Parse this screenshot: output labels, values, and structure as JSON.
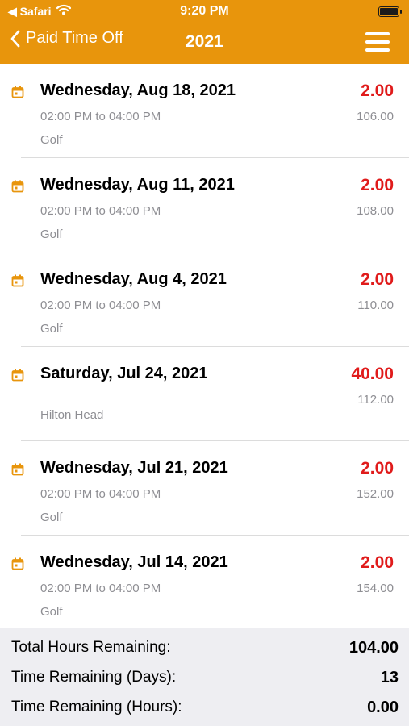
{
  "status_bar": {
    "back_app": "◀ Safari",
    "time": "9:20 PM"
  },
  "nav": {
    "back_label": "Paid Time Off",
    "title": "2021"
  },
  "entries": [
    {
      "date": "Wednesday, Aug 18, 2021",
      "time": "02:00 PM to 04:00 PM",
      "note": "Golf",
      "hours": "2.00",
      "balance": "106.00"
    },
    {
      "date": "Wednesday, Aug 11, 2021",
      "time": "02:00 PM to 04:00 PM",
      "note": "Golf",
      "hours": "2.00",
      "balance": "108.00"
    },
    {
      "date": "Wednesday, Aug 4, 2021",
      "time": "02:00 PM to 04:00 PM",
      "note": "Golf",
      "hours": "2.00",
      "balance": "110.00"
    },
    {
      "date": "Saturday, Jul 24, 2021",
      "time": "",
      "note": "Hilton Head",
      "hours": "40.00",
      "balance": "112.00"
    },
    {
      "date": "Wednesday, Jul 21, 2021",
      "time": "02:00 PM to 04:00 PM",
      "note": "Golf",
      "hours": "2.00",
      "balance": "152.00"
    },
    {
      "date": "Wednesday, Jul 14, 2021",
      "time": "02:00 PM to 04:00 PM",
      "note": "Golf",
      "hours": "2.00",
      "balance": "154.00"
    }
  ],
  "summary": {
    "total_hours_label": "Total Hours Remaining:",
    "total_hours_value": "104.00",
    "days_label": "Time Remaining (Days):",
    "days_value": "13",
    "hours_label": "Time Remaining (Hours):",
    "hours_value": "0.00"
  },
  "colors": {
    "accent": "#E8950C",
    "negative": "#E01B1B",
    "summary_bg": "#EEEEF2"
  },
  "icons": {
    "back": "chevron-left-icon",
    "menu": "hamburger-menu-icon",
    "entry": "calendar-icon"
  }
}
